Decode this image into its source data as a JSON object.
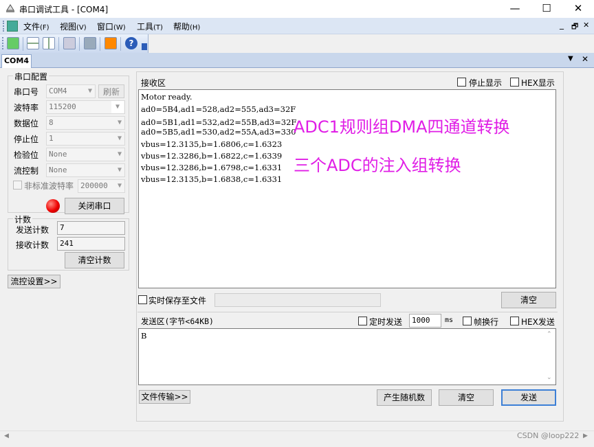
{
  "window": {
    "title": "串口调试工具 - [COM4]",
    "minimize": "—",
    "maximize": "☐",
    "close": "✕"
  },
  "menu": [
    {
      "label": "文件",
      "key": "(F)"
    },
    {
      "label": "视图",
      "key": "(V)"
    },
    {
      "label": "窗口",
      "key": "(W)"
    },
    {
      "label": "工具",
      "key": "(T)"
    },
    {
      "label": "帮助",
      "key": "(H)"
    }
  ],
  "mdi_controls": {
    "minimize": "_",
    "restore": "🗗",
    "close": "✕"
  },
  "tabs": [
    {
      "label": "COM4"
    }
  ],
  "serial_config": {
    "legend": "串口配置",
    "port": {
      "label": "串口号",
      "value": "COM4",
      "refresh": "刷新"
    },
    "baud": {
      "label": "波特率",
      "value": "115200"
    },
    "databits": {
      "label": "数据位",
      "value": "8"
    },
    "stopbits": {
      "label": "停止位",
      "value": "1"
    },
    "parity": {
      "label": "检验位",
      "value": "None"
    },
    "flow": {
      "label": "流控制",
      "value": "None"
    },
    "nonstd": {
      "label": "非标准波特率",
      "value": "200000"
    },
    "close_port": "关闭串口"
  },
  "counter": {
    "legend": "计数",
    "sent": {
      "label": "发送计数",
      "value": "7"
    },
    "recv": {
      "label": "接收计数",
      "value": "241"
    },
    "clear": "清空计数"
  },
  "flow_settings": "流控设置>>",
  "receive": {
    "title": "接收区",
    "stop_display": "停止显示",
    "hex_display": "HEX显示",
    "lines": [
      "Motor ready.",
      "ad0=5B4,ad1=528,ad2=555,ad3=32F",
      "ad0=5B1,ad1=532,ad2=55B,ad3=32F",
      "ad0=5B5,ad1=530,ad2=55A,ad3=330",
      "vbus=12.3135,b=1.6806,c=1.6323",
      "vbus=12.3286,b=1.6822,c=1.6339",
      "vbus=12.3286,b=1.6798,c=1.6331",
      "vbus=12.3135,b=1.6838,c=1.6331"
    ],
    "annotation1": "ADC1规则组DMA四通道转换",
    "annotation2": "三个ADC的注入组转换",
    "realtime_save": "实时保存至文件",
    "clear": "清空"
  },
  "send": {
    "title": "发送区(字节<64KB)",
    "timed": "定时发送",
    "interval": "1000",
    "unit": "ms",
    "frame_newline": "帧换行",
    "hex_send": "HEX发送",
    "content": "B",
    "file_transfer": "文件传输>>",
    "random": "产生随机数",
    "clear": "清空",
    "send": "发送"
  },
  "watermark": "CSDN @loop222"
}
